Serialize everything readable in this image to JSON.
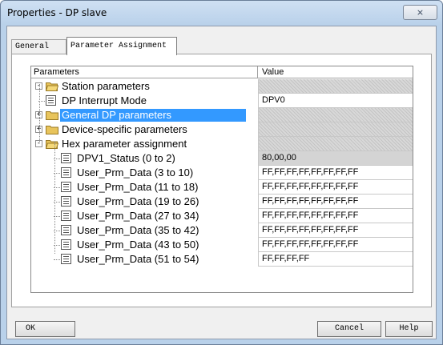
{
  "window": {
    "title": "Properties - DP slave",
    "close_glyph": "⨯"
  },
  "tabs": [
    {
      "label": "General"
    },
    {
      "label": "Parameter Assignment"
    }
  ],
  "grid": {
    "headers": {
      "parameters": "Parameters",
      "value": "Value"
    },
    "rows": [
      {
        "label": "Station parameters",
        "value": "",
        "icon": "open-folder-icon",
        "expander": "-"
      },
      {
        "label": "DP Interrupt Mode",
        "value": "DPV0",
        "icon": "document-icon"
      },
      {
        "label": "General DP parameters",
        "value": "",
        "icon": "folder-icon",
        "expander": "+",
        "selected": true
      },
      {
        "label": "Device-specific parameters",
        "value": "",
        "icon": "folder-icon",
        "expander": "+"
      },
      {
        "label": "Hex parameter assignment",
        "value": "",
        "icon": "open-folder-icon",
        "expander": "-"
      },
      {
        "label": "DPV1_Status (0 to 2)",
        "value": "80,00,00",
        "icon": "document-icon"
      },
      {
        "label": "User_Prm_Data (3 to 10)",
        "value": "FF,FF,FF,FF,FF,FF,FF,FF",
        "icon": "document-icon"
      },
      {
        "label": "User_Prm_Data (11 to 18)",
        "value": "FF,FF,FF,FF,FF,FF,FF,FF",
        "icon": "document-icon"
      },
      {
        "label": "User_Prm_Data (19 to 26)",
        "value": "FF,FF,FF,FF,FF,FF,FF,FF",
        "icon": "document-icon"
      },
      {
        "label": "User_Prm_Data (27 to 34)",
        "value": "FF,FF,FF,FF,FF,FF,FF,FF",
        "icon": "document-icon"
      },
      {
        "label": "User_Prm_Data (35 to 42)",
        "value": "FF,FF,FF,FF,FF,FF,FF,FF",
        "icon": "document-icon"
      },
      {
        "label": "User_Prm_Data (43 to 50)",
        "value": "FF,FF,FF,FF,FF,FF,FF,FF",
        "icon": "document-icon"
      },
      {
        "label": "User_Prm_Data (51 to 54)",
        "value": "FF,FF,FF,FF",
        "icon": "document-icon"
      }
    ]
  },
  "buttons": {
    "ok": "OK",
    "cancel": "Cancel",
    "help": "Help"
  },
  "colors": {
    "selection": "#3399ff",
    "folder": "#e8c45c",
    "titlebar": "#b9d1ea"
  }
}
